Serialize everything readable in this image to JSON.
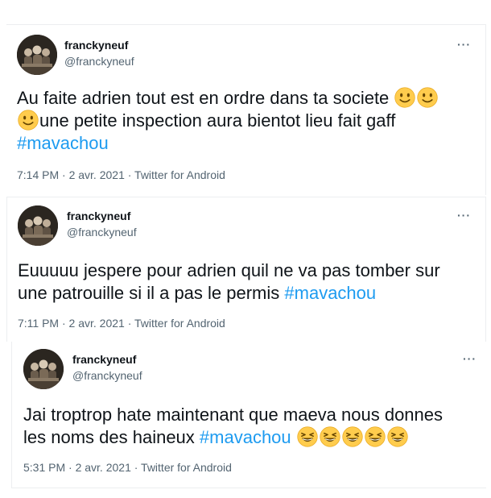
{
  "tweets": [
    {
      "display_name": "franckyneuf",
      "handle": "@franckyneuf",
      "more": "···",
      "text_line1": "Au faite adrien tout est en ordre dans ta societe",
      "emojis_line1": [
        "slightly-smiling-face",
        "slightly-smiling-face"
      ],
      "emoji_line2_lead": "slightly-smiling-face",
      "text_line2": "une petite inspection aura bientot lieu fait gaff",
      "hashtag": "#mavachou",
      "meta": "7:14 PM · 2 avr. 2021 · Twitter for Android"
    },
    {
      "display_name": "franckyneuf",
      "handle": "@franckyneuf",
      "more": "···",
      "text_line1": "Euuuuu jespere pour adrien quil ne va pas tomber sur",
      "text_line2": "une patrouille si il a pas le permis ",
      "hashtag": "#mavachou",
      "meta": "7:11 PM · 2 avr. 2021 · Twitter for Android"
    },
    {
      "display_name": "franckyneuf",
      "handle": "@franckyneuf",
      "more": "···",
      "text_line1": "Jai troptrop  hate maintenant que maeva nous donnes",
      "text_line2": "les noms des haineux ",
      "hashtag": "#mavachou",
      "emojis_line2": [
        "grinning-squinting-face",
        "grinning-squinting-face",
        "grinning-squinting-face",
        "grinning-squinting-face",
        "grinning-squinting-face"
      ],
      "meta": "5:31 PM · 2 avr. 2021 · Twitter for Android"
    }
  ],
  "colors": {
    "text": "#0f1419",
    "secondary": "#536471",
    "link": "#1d9bf0",
    "border": "#eceef0",
    "emoji": "#ffcc33"
  }
}
